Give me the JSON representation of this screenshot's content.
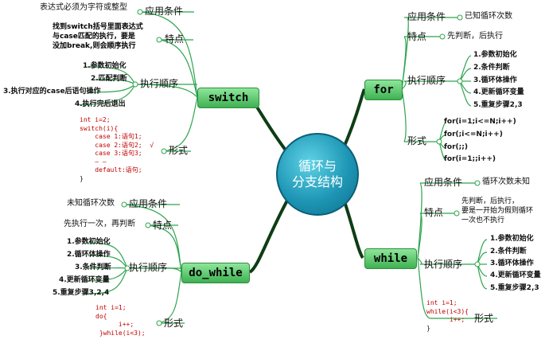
{
  "center": {
    "line1": "循环与",
    "line2": "分支结构"
  },
  "switch": {
    "title": "switch",
    "cond_label": "应用条件",
    "cond_text": "表达式必须为字符或整型",
    "feature_label": "特点",
    "feature_text": [
      "找到switch括号里面表达式",
      "与case匹配的执行，要是",
      "没加break,则会顺序执行"
    ],
    "order_label": "执行顺序",
    "steps": [
      "1.参数初始化",
      "2.匹配判断",
      "3.执行对应的case后语句操作",
      "4.执行完后退出"
    ],
    "form_label": "形式",
    "code": [
      "int i=2;",
      "switch(i){",
      "    case 1:语句1;",
      "    case 2:语句2;  √",
      "    case 3:语句3;",
      "    — —",
      "    default:语句;",
      "",
      "}"
    ]
  },
  "for": {
    "title": "for",
    "cond_label": "应用条件",
    "cond_text": "已知循环次数",
    "feature_label": "特点",
    "feature_text": "先判断，后执行",
    "order_label": "执行顺序",
    "steps": [
      "1.参数初始化",
      "2.条件判断",
      "3.循环体操作",
      "4.更新循环变量",
      "5.重复步骤2,3"
    ],
    "form_label": "形式",
    "forms": [
      "for(i=1;i<=N;i++)",
      "for(;i<=N;i++)",
      "for(;;)",
      "for(i=1;;i++)"
    ]
  },
  "do_while": {
    "title": "do_while",
    "cond_label": "应用条件",
    "cond_text": "未知循环次数",
    "feature_label": "特点",
    "feature_text": "先执行一次，再判断",
    "order_label": "执行顺序",
    "steps": [
      "1.参数初始化",
      "2.循环体操作",
      "3.条件判断",
      "4.更新循环变量",
      "5.重复步骤3,2,4"
    ],
    "form_label": "形式",
    "code": [
      "int i=1;",
      "do{",
      "      i++;",
      "",
      " }while(i<3);"
    ]
  },
  "while": {
    "title": "while",
    "cond_label": "应用条件",
    "cond_text": "循环次数未知",
    "feature_label": "特点",
    "feature_text": [
      "先判断，后执行，",
      "要是一开始为假则循环",
      "一次也不执行"
    ],
    "order_label": "执行顺序",
    "steps": [
      "1.参数初始化",
      "2.条件判断",
      "3.循环体操作",
      "4.更新循环变量",
      "5.重复步骤2,3"
    ],
    "form_label": "形式",
    "code": [
      "int i=1;",
      "while(i<3){",
      "      i++;",
      "",
      "}"
    ]
  },
  "colors": {
    "branch": "#3fb152",
    "line": "#2ea44f",
    "center": "#1e96b5",
    "code": "#c00000"
  }
}
